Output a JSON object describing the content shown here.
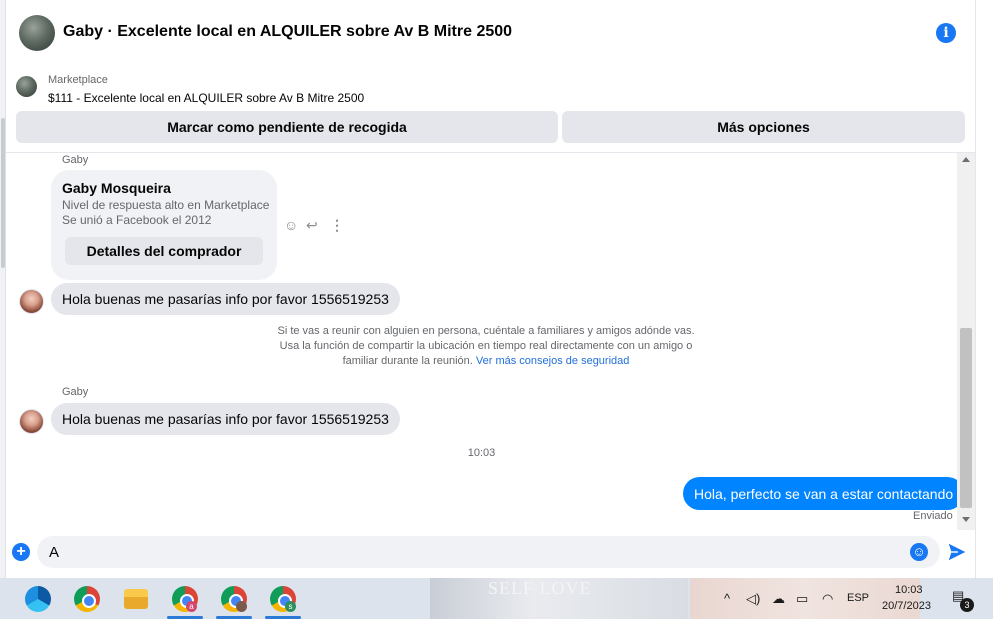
{
  "header": {
    "title": "Gaby · Excelente local en ALQUILER sobre Av B Mitre 2500",
    "info_icon": "info-icon"
  },
  "listing": {
    "label": "Marketplace",
    "price_title": "$111 - Excelente local en ALQUILER sobre Av B Mitre 2500"
  },
  "actions": {
    "mark_pending": "Marcar como pendiente de recogida",
    "more_options": "Más opciones"
  },
  "chat": {
    "sender_top": "Gaby",
    "profile_card": {
      "name": "Gaby Mosqueira",
      "response": "Nivel de respuesta alto en Marketplace",
      "joined": "Se unió a Facebook el 2012",
      "details_button": "Detalles del comprador"
    },
    "message_1": "Hola buenas me pasarías info por favor 1556519253",
    "safety_text_1": "Si te vas a reunir con alguien en persona, cuéntale a familiares y amigos adónde vas.",
    "safety_text_2": "Usa la función de compartir la ubicación en tiempo real directamente con un amigo o",
    "safety_text_3": "familiar durante la reunión.",
    "safety_link": "Ver más consejos de seguridad",
    "sender_mid": "Gaby",
    "message_2": "Hola buenas me pasarías info por favor 1556519253",
    "timestamp": "10:03",
    "reply": "Hola, perfecto se van a estar contactando",
    "sent_status": "Enviado"
  },
  "composer": {
    "value": "A",
    "plus_icon": "+",
    "emoji_icon": "☺"
  },
  "taskbar": {
    "wallpaper_text": "SELF LOVE",
    "badge_a": "a",
    "badge_s": "s",
    "language": "ESP",
    "time": "10:03",
    "date": "20/7/2023",
    "notifications": "3"
  },
  "colors": {
    "accent": "#1877f2",
    "outgoing_bubble": "#0084ff",
    "incoming_bubble": "#e4e6eb"
  }
}
